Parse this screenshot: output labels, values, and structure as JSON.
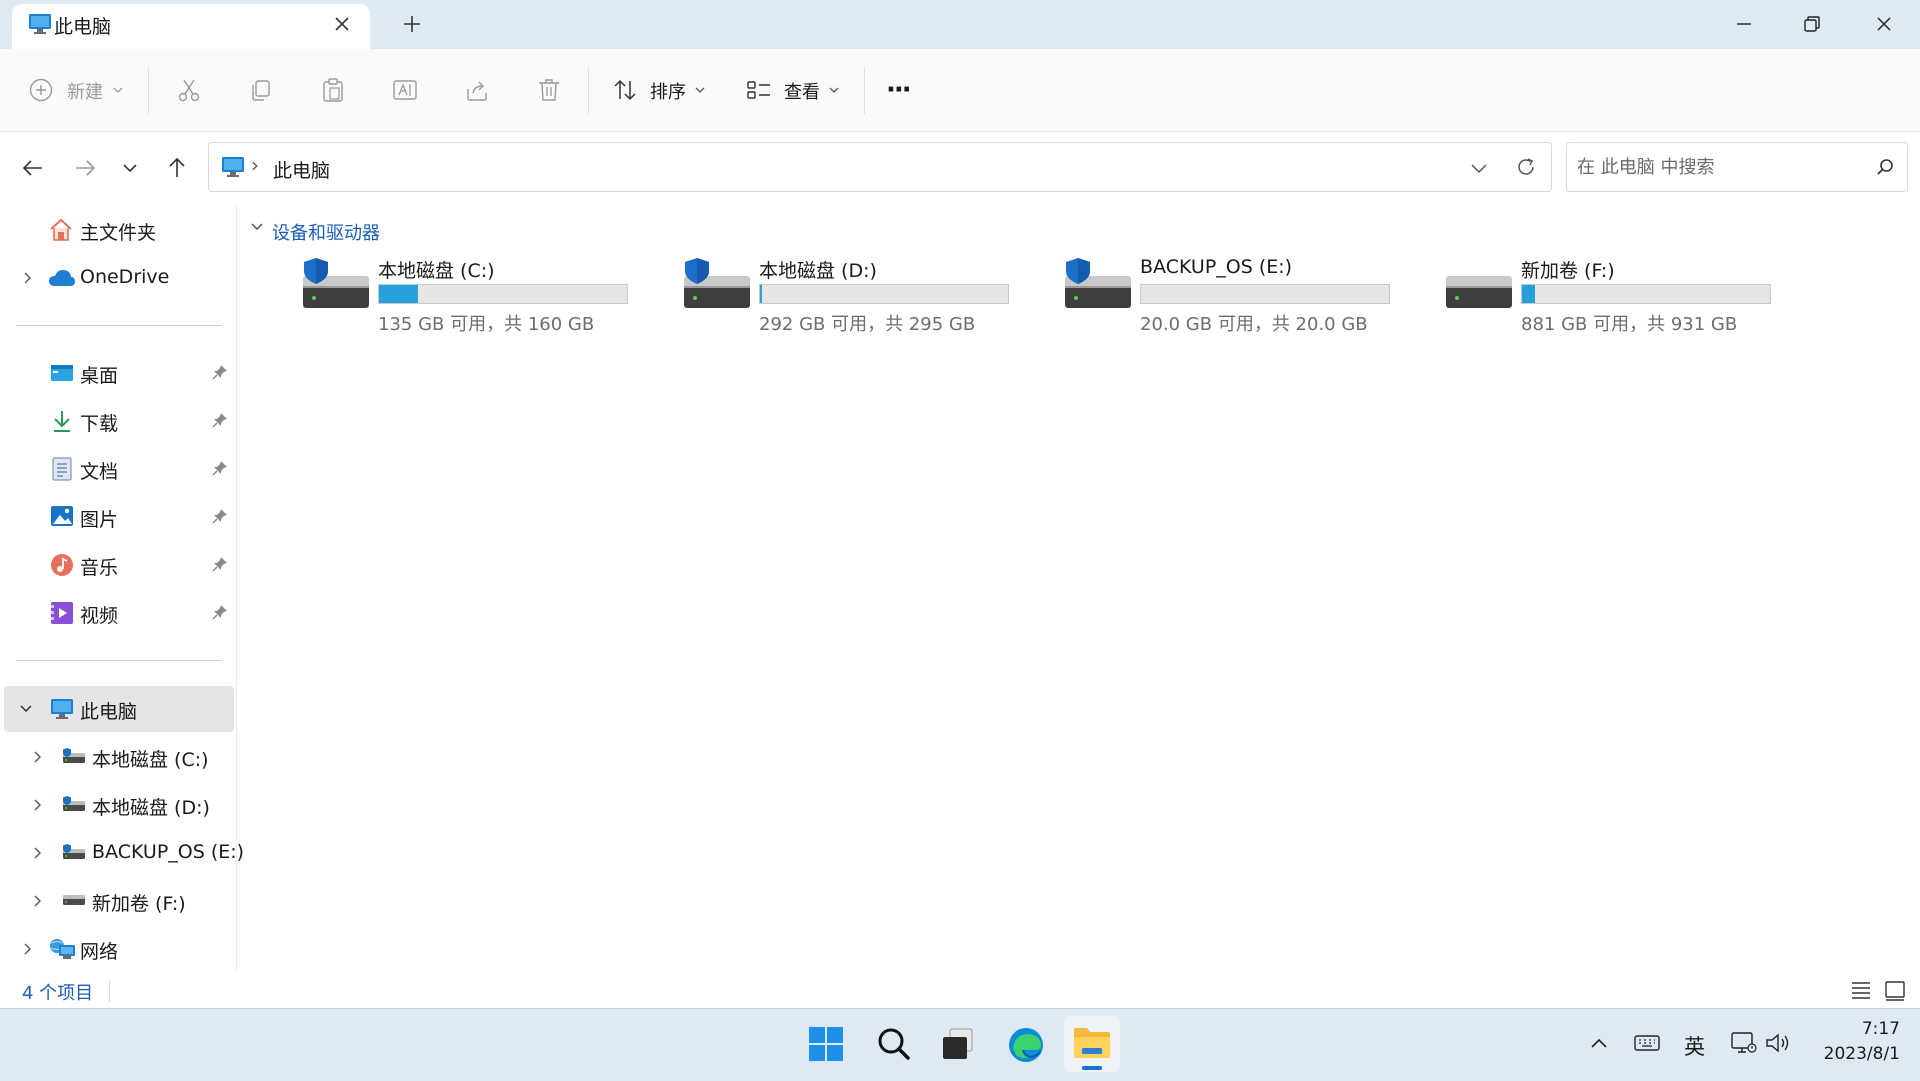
{
  "window": {
    "tab_title": "此电脑",
    "new_tab": "+"
  },
  "toolbar": {
    "new_label": "新建",
    "sort_label": "排序",
    "view_label": "查看",
    "more_label": "···"
  },
  "address": {
    "separator": "›",
    "location": "此电脑",
    "search_placeholder": "在 此电脑 中搜索"
  },
  "sidebar": {
    "home": "主文件夹",
    "onedrive": "OneDrive",
    "quick": [
      {
        "label": "桌面",
        "icon": "desktop-icon"
      },
      {
        "label": "下载",
        "icon": "download-icon"
      },
      {
        "label": "文档",
        "icon": "documents-icon"
      },
      {
        "label": "图片",
        "icon": "pictures-icon"
      },
      {
        "label": "音乐",
        "icon": "music-icon"
      },
      {
        "label": "视频",
        "icon": "videos-icon"
      }
    ],
    "this_pc": "此电脑",
    "drives": [
      "本地磁盘 (C:)",
      "本地磁盘 (D:)",
      "BACKUP_OS (E:)",
      "新加卷 (F:)"
    ],
    "network": "网络"
  },
  "main": {
    "group_label": "设备和驱动器",
    "drives": [
      {
        "name": "本地磁盘 (C:)",
        "space": "135 GB 可用，共 160 GB",
        "used_fraction": 0.156,
        "shield": true
      },
      {
        "name": "本地磁盘 (D:)",
        "space": "292 GB 可用，共 295 GB",
        "used_fraction": 0.01,
        "shield": true
      },
      {
        "name": "BACKUP_OS (E:)",
        "space": "20.0 GB 可用，共 20.0 GB",
        "used_fraction": 0.0,
        "shield": true
      },
      {
        "name": "新加卷 (F:)",
        "space": "881 GB 可用，共 931 GB",
        "used_fraction": 0.054,
        "shield": false
      }
    ]
  },
  "status": {
    "item_count": "4 个项目"
  },
  "taskbar": {
    "ime": "英",
    "time": "7:17",
    "date": "2023/8/1"
  },
  "colors": {
    "accent": "#1a5fb4",
    "bar_fill": "#26a0da",
    "titlebar": "#dde9f3",
    "taskbar": "#dfe9f3"
  }
}
